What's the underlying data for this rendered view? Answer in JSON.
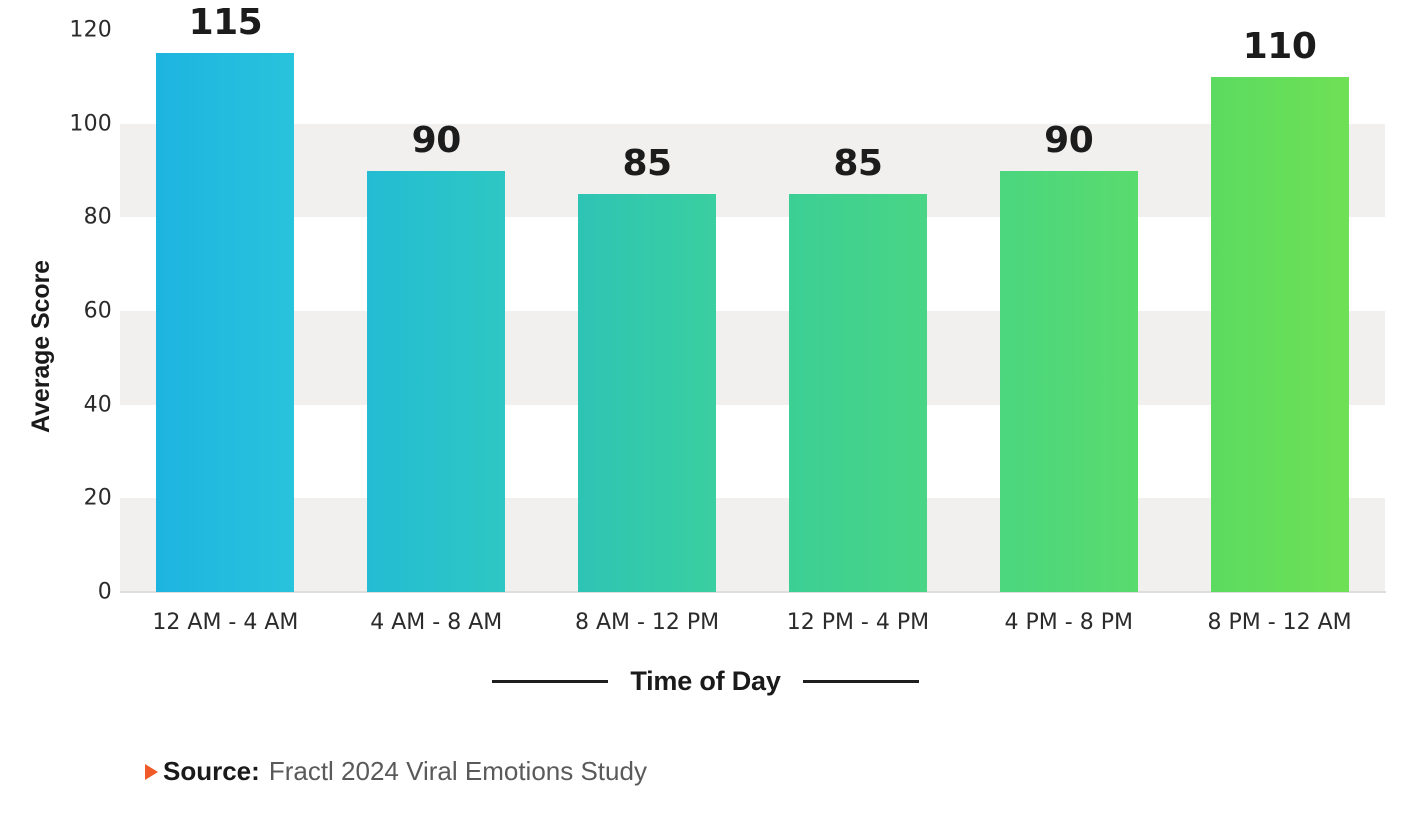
{
  "chart_data": {
    "type": "bar",
    "title": "",
    "xlabel": "Time of Day",
    "ylabel": "Average Score",
    "categories": [
      "12 AM - 4 AM",
      "4 AM - 8 AM",
      "8 AM - 12 PM",
      "12 PM - 4 PM",
      "4 PM - 8 PM",
      "8 PM - 12 AM"
    ],
    "values": [
      115,
      90,
      85,
      85,
      90,
      110
    ],
    "value_labels": [
      "115",
      "90",
      "85",
      "85",
      "90",
      "110"
    ],
    "ylim": [
      0,
      120
    ],
    "yticks": [
      0,
      20,
      40,
      60,
      80,
      100,
      120
    ],
    "ytick_labels": [
      "0",
      "20",
      "40",
      "60",
      "80",
      "100",
      "120"
    ],
    "grid": false,
    "banded_background": true,
    "band_ranges": [
      [
        0,
        20
      ],
      [
        40,
        60
      ],
      [
        80,
        100
      ]
    ],
    "legend": "none",
    "bar_colors": [
      {
        "from": "#1eb4e0",
        "to": "#28c3dc"
      },
      {
        "from": "#23bcd3",
        "to": "#2ec7c3"
      },
      {
        "from": "#2ec4b4",
        "to": "#3acfa0"
      },
      {
        "from": "#3ccf95",
        "to": "#49d585"
      },
      {
        "from": "#4bd67f",
        "to": "#59db6d"
      },
      {
        "from": "#5cdb60",
        "to": "#6ee056"
      }
    ]
  },
  "axis": {
    "y_title": "Average Score",
    "x_title": "Time of Day"
  },
  "colors": {
    "band": "#f2f0ee",
    "baseline": "#dedede",
    "text_dark": "#1a1a1a",
    "text_muted": "#5a5a5a",
    "accent": "#ef5a28"
  },
  "source": {
    "marker_icon": "triangle-right-icon",
    "label": "Source:",
    "text": "Fractl 2024 Viral Emotions Study"
  }
}
